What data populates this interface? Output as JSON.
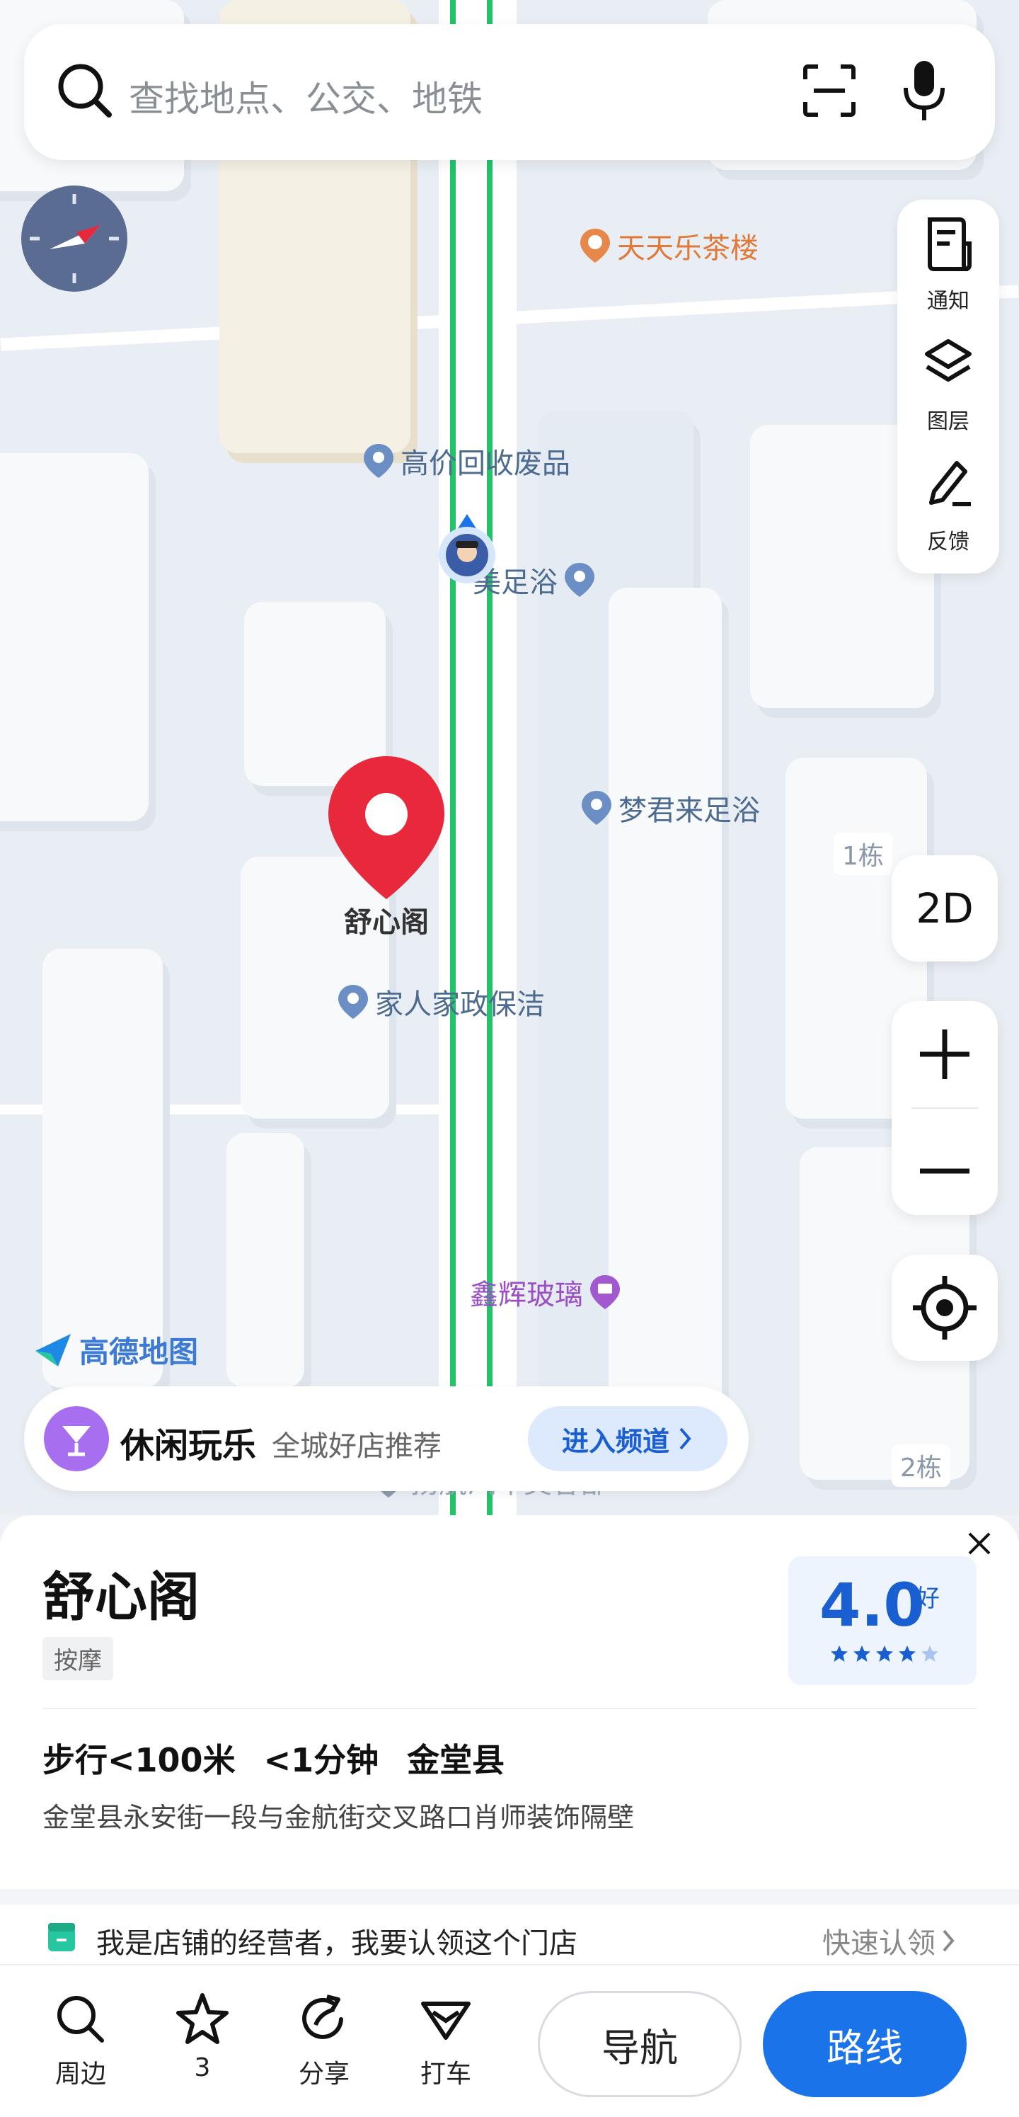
{
  "search": {
    "placeholder": "查找地点、公交、地铁"
  },
  "toolbar": {
    "notify_label": "通知",
    "layers_label": "图层",
    "feedback_label": "反馈",
    "view_mode_label": "2D"
  },
  "map": {
    "pois": [
      {
        "name": "天天乐茶楼",
        "color": "#e07a3a"
      },
      {
        "name": "高价回收废品",
        "color": "#4d6b90"
      },
      {
        "name": "美足浴",
        "color": "#4d6b90"
      },
      {
        "name": "梦君来足浴",
        "color": "#4d6b90"
      },
      {
        "name": "家人家政保洁",
        "color": "#4d6b90"
      },
      {
        "name": "鑫辉玻璃",
        "color": "#9b4fc4"
      },
      {
        "name": "扬航汽车美容部",
        "color": "#9aa7b6"
      }
    ],
    "building_labels": [
      "1栋",
      "2栋"
    ],
    "selected_marker_label": "舒心阁",
    "brand": "高德地图",
    "rail_color": "#22c36b"
  },
  "promo": {
    "title": "休闲玩乐",
    "subtitle": "全城好店推荐",
    "button_label": "进入频道"
  },
  "place": {
    "name": "舒心阁",
    "category": "按摩",
    "rating": "4.0",
    "rating_text": "好",
    "stars_filled": 4,
    "stars_total": 5,
    "walk": "步行<100米",
    "time": "<1分钟",
    "district": "金堂县",
    "address": "金堂县永安街一段与金航街交叉路口肖师装饰隔壁"
  },
  "claim": {
    "text": "我是店铺的经营者，我要认领这个门店",
    "action": "快速认领"
  },
  "bottom_bar": {
    "nearby_label": "周边",
    "favorites_count": "3",
    "share_label": "分享",
    "taxi_label": "打车",
    "navigate_label": "导航",
    "route_label": "路线"
  },
  "colors": {
    "accent": "#1a73e8",
    "marker": "#e8293c"
  }
}
